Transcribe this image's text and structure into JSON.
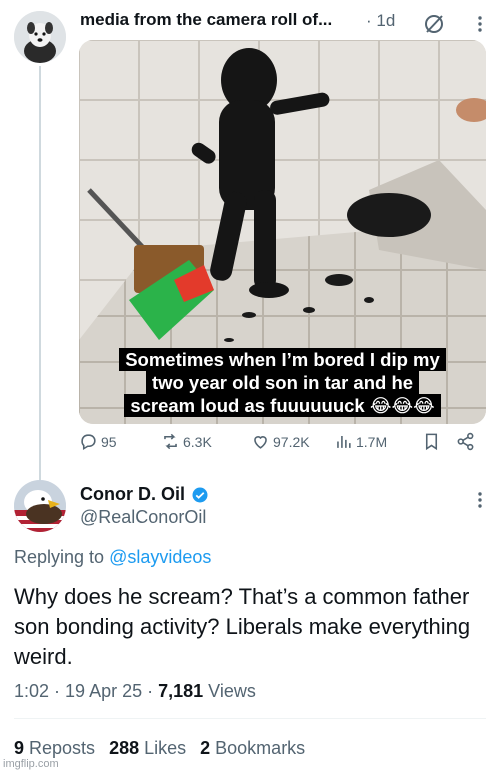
{
  "original_tweet": {
    "author_name": "media from the camera roll of...",
    "time": "· 1d",
    "caption_lines": [
      "Sometimes when I’m bored I dip my",
      "two year old son in tar and he",
      "scream loud as fuuuuuuck 😂😂😂"
    ],
    "stats": {
      "replies": "95",
      "reposts": "6.3K",
      "likes": "97.2K",
      "views": "1.7M"
    }
  },
  "reply_tweet": {
    "author_name": "Conor D. Oil",
    "handle": "@RealConorOil",
    "replying_prefix": "Replying to",
    "replying_to": "@slayvideos",
    "text": "Why does he scream? That’s a common father son bonding activity? Liberals make everything weird.",
    "time": "1:02",
    "date": "19 Apr 25",
    "views_count": "7,181",
    "views_label": "Views",
    "reposts_count": "9",
    "reposts_label": "Reposts",
    "likes_count": "288",
    "likes_label": "Likes",
    "bookmarks_count": "2",
    "bookmarks_label": "Bookmarks"
  },
  "watermark": "imgflip.com",
  "colors": {
    "link": "#1d9bf0",
    "secondary_text": "#536471",
    "verified_badge": "#1d9bf0"
  }
}
